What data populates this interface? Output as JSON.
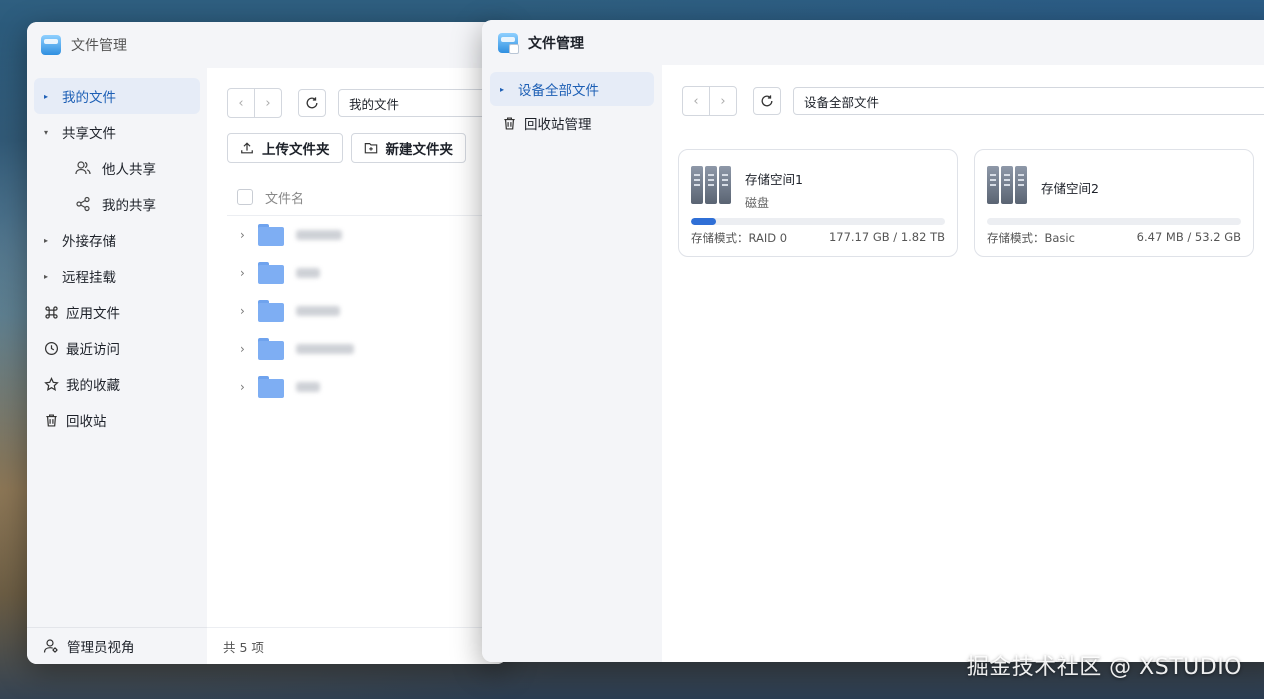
{
  "back_window": {
    "title": "文件管理",
    "sidebar": {
      "items": [
        {
          "label": "我的文件"
        },
        {
          "label": "共享文件"
        },
        {
          "label": "他人共享"
        },
        {
          "label": "我的共享"
        },
        {
          "label": "外接存储"
        },
        {
          "label": "远程挂载"
        },
        {
          "label": "应用文件"
        },
        {
          "label": "最近访问"
        },
        {
          "label": "我的收藏"
        },
        {
          "label": "回收站"
        }
      ],
      "footer_label": "管理员视角"
    },
    "toolbar": {
      "path": "我的文件"
    },
    "actions": {
      "upload_label": "上传文件夹",
      "new_folder_label": "新建文件夹"
    },
    "list": {
      "column_name": "文件名"
    },
    "status_text": "共 5 项"
  },
  "front_window": {
    "title": "文件管理",
    "sidebar": {
      "items": [
        {
          "label": "设备全部文件"
        },
        {
          "label": "回收站管理"
        }
      ]
    },
    "toolbar": {
      "path": "设备全部文件"
    },
    "cards": [
      {
        "name": "存储空间1",
        "subtitle": "磁盘",
        "mode": "存储模式：RAID 0",
        "usage": "177.17 GB / 1.82 TB",
        "usage_fraction": 0.097
      },
      {
        "name": "存储空间2",
        "subtitle": "",
        "mode": "存储模式：Basic",
        "usage": "6.47 MB / 53.2 GB",
        "usage_fraction": 0.0
      }
    ]
  },
  "watermark": "掘金技术社区 @ XSTUDIO",
  "colors": {
    "accent": "#1d5fb5",
    "progress": "#2f6fd6",
    "folder": "#7eaef3"
  }
}
